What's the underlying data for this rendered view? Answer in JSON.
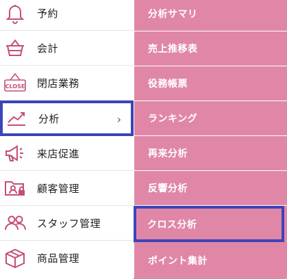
{
  "colors": {
    "accent": "#e087a8",
    "icon": "#c44d7b",
    "highlight": "#3b44b8"
  },
  "menu": {
    "items": [
      {
        "label": "予約",
        "icon": "bell-icon"
      },
      {
        "label": "会計",
        "icon": "basket-icon"
      },
      {
        "label": "閉店業務",
        "icon": "close-sign-icon",
        "icon_text": "CLOSE"
      },
      {
        "label": "分析",
        "icon": "trend-chart-icon",
        "chevron": "›"
      },
      {
        "label": "来店促進",
        "icon": "megaphone-icon"
      },
      {
        "label": "顧客管理",
        "icon": "customer-folder-icon"
      },
      {
        "label": "スタッフ管理",
        "icon": "staff-icon"
      },
      {
        "label": "商品管理",
        "icon": "box-icon"
      }
    ]
  },
  "submenu": {
    "items": [
      {
        "label": "分析サマリ"
      },
      {
        "label": "売上推移表"
      },
      {
        "label": "役務帳票"
      },
      {
        "label": "ランキング"
      },
      {
        "label": "再来分析"
      },
      {
        "label": "反響分析"
      },
      {
        "label": "クロス分析"
      },
      {
        "label": "ポイント集計"
      }
    ]
  }
}
